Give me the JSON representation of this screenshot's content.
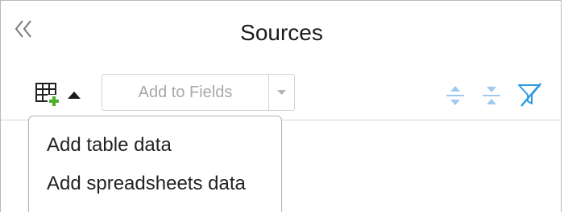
{
  "panel": {
    "title": "Sources",
    "collapse_icon": "double-chevron-left-icon"
  },
  "toolbar": {
    "add_table_icon": "table-add-icon",
    "add_table_caret_icon": "caret-up-icon",
    "fields_button_label": "Add to Fields",
    "fields_dropdown_icon": "chevron-down-icon",
    "expand_all_icon": "expand-vertical-icon",
    "collapse_all_icon": "collapse-vertical-icon",
    "clear_filter_icon": "filter-off-icon"
  },
  "dropdown_menu": {
    "items": [
      {
        "label": "Add table data"
      },
      {
        "label": "Add spreadsheets data"
      }
    ]
  },
  "colors": {
    "accent_blue": "#2e9be0",
    "light_blue": "#9fc9ee",
    "add_green": "#4caf2a",
    "disabled_text": "#a9a9a9"
  }
}
